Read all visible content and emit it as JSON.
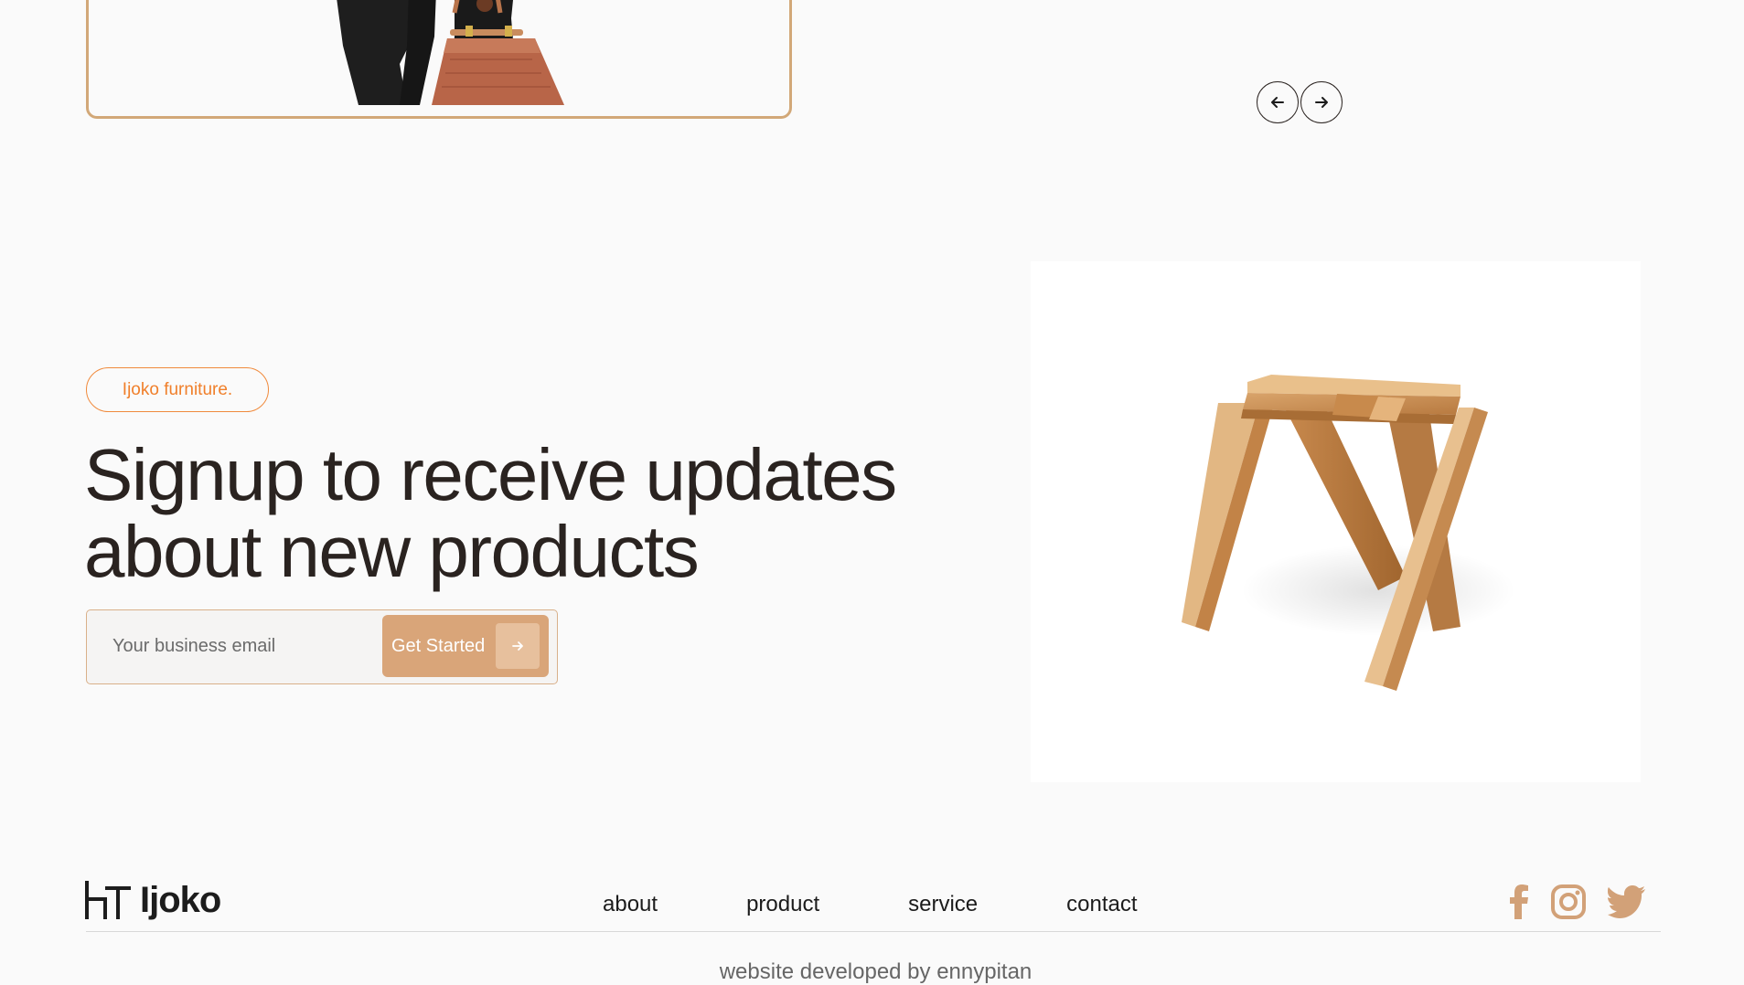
{
  "hero": {
    "carousel": {
      "prev_icon": "arrow-left-icon",
      "next_icon": "arrow-right-icon"
    }
  },
  "signup": {
    "badge": "Ijoko furniture.",
    "headline_line1": "Signup to receive updates",
    "headline_line2": "about new products",
    "email_placeholder": "Your business email",
    "button_label": "Get Started",
    "button_icon": "arrow-right-icon"
  },
  "footer": {
    "logo": "Ijoko",
    "nav": [
      "about",
      "product",
      "service",
      "contact"
    ],
    "social": [
      "facebook-icon",
      "instagram-icon",
      "twitter-icon"
    ],
    "credit": "website developed by ennypitan"
  },
  "colors": {
    "accent": "#d9a579",
    "badge_orange": "#f07f2a",
    "text_dark": "#2a2320",
    "background": "#fafafa"
  }
}
